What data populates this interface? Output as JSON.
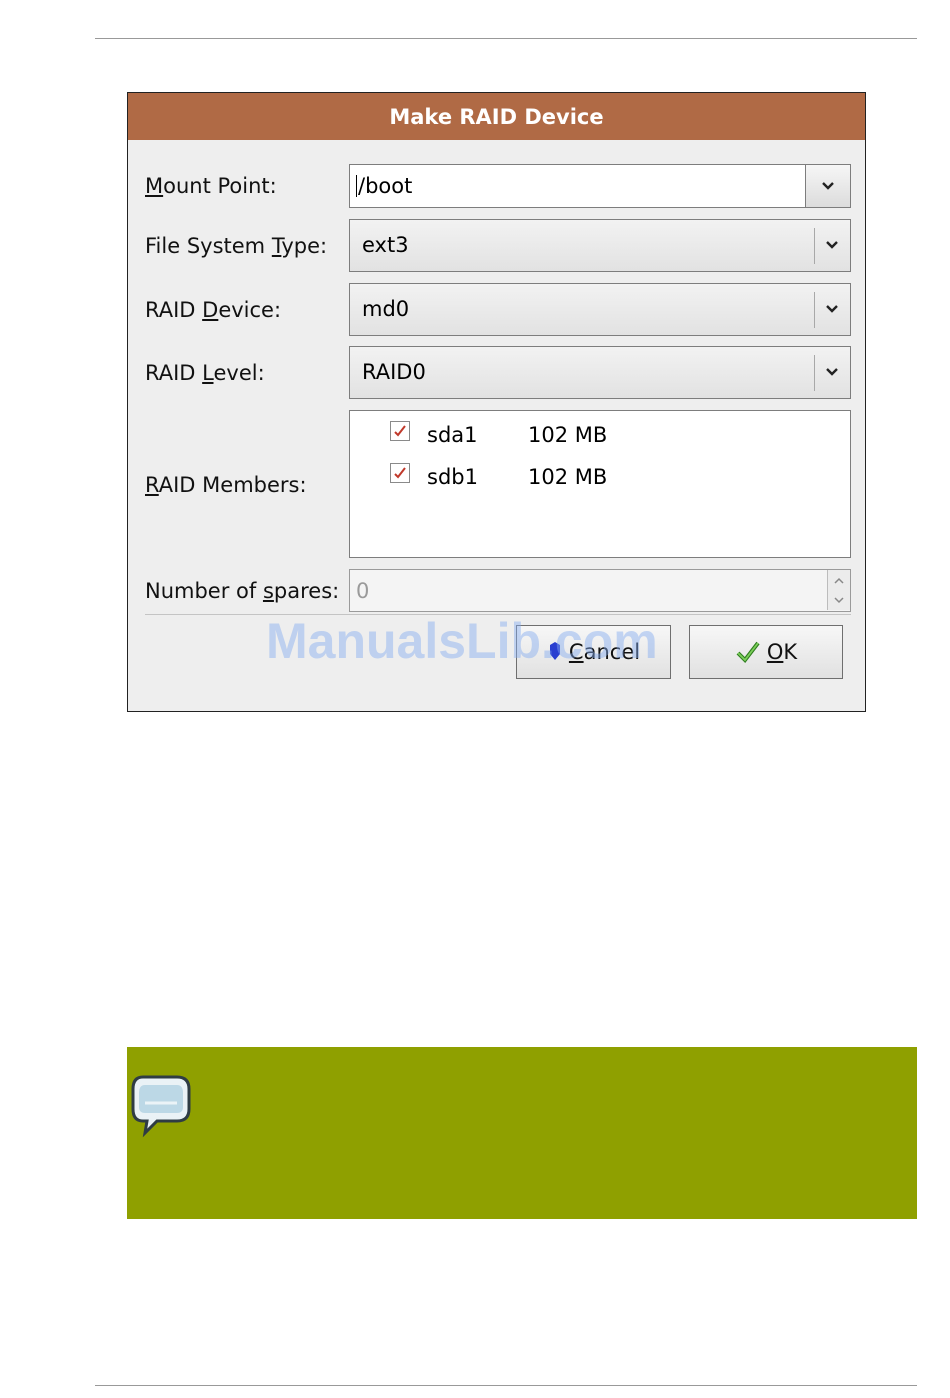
{
  "dialog": {
    "title": "Make RAID Device",
    "mount_point": {
      "label_pre": "",
      "label_key": "M",
      "label_post": "ount Point:",
      "value": "/boot"
    },
    "fs_type": {
      "label_pre": "File System ",
      "label_key": "T",
      "label_post": "ype:",
      "value": "ext3"
    },
    "raid_device": {
      "label_pre": "RAID ",
      "label_key": "D",
      "label_post": "evice:",
      "value": "md0"
    },
    "raid_level": {
      "label_pre": "RAID ",
      "label_key": "L",
      "label_post": "evel:",
      "value": "RAID0"
    },
    "raid_members": {
      "label_pre": "",
      "label_key": "R",
      "label_post": "AID Members:",
      "items": [
        {
          "name": "sda1",
          "size": "102 MB",
          "checked": true
        },
        {
          "name": "sdb1",
          "size": "102 MB",
          "checked": true
        }
      ]
    },
    "spares": {
      "label_pre": "Number of ",
      "label_key": "s",
      "label_post": "pares:",
      "value": "0"
    },
    "cancel_button": {
      "key": "C",
      "rest": "ancel"
    },
    "ok_button": {
      "key": "O",
      "rest": "K"
    }
  },
  "watermark": "ManualsLib.com",
  "colors": {
    "titlebar": "#b06a45",
    "note_background": "#8fa000",
    "checkmark": "#c0392b",
    "ok_icon": "#3a9a2a",
    "cancel_icon": "#2a3fd0"
  },
  "icons": {
    "combo_arrow": "chevron-down-icon",
    "member_check": "checkmark-icon",
    "spin_up": "spin-up-icon",
    "spin_down": "spin-down-icon",
    "ok": "check-icon",
    "cancel": "cancel-icon",
    "note": "speech-bubble-icon"
  }
}
